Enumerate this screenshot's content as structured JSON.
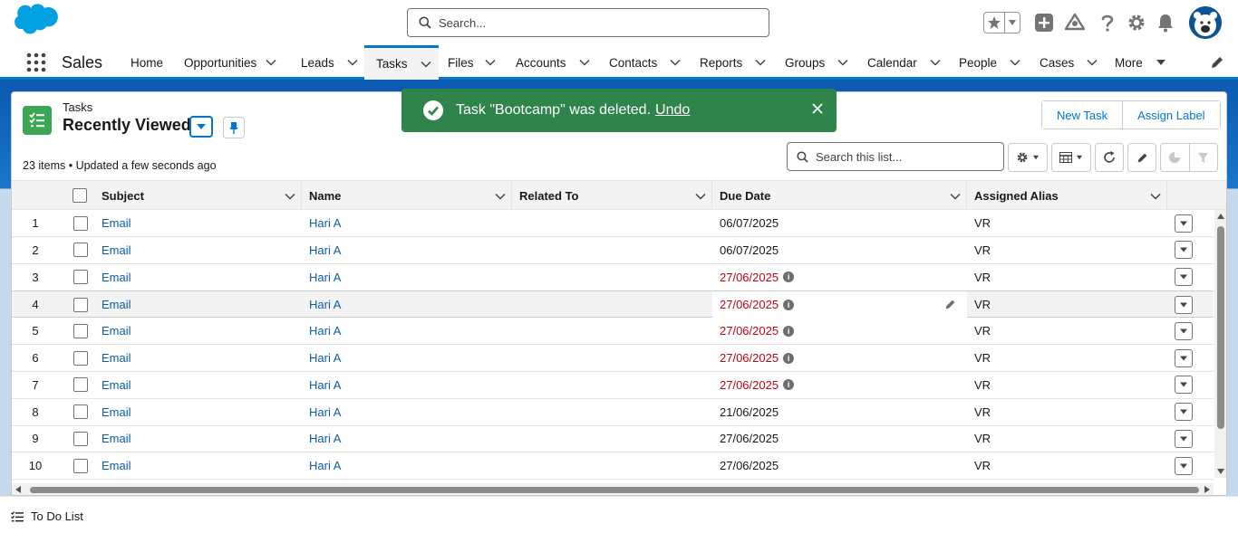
{
  "header": {
    "search_placeholder": "Search...",
    "icons": [
      "favorites-star-icon",
      "add-icon",
      "trailhead-icon",
      "help-icon",
      "setup-gear-icon",
      "notifications-bell-icon",
      "avatar"
    ]
  },
  "nav": {
    "app_name": "Sales",
    "items": [
      {
        "label": "Home"
      },
      {
        "label": "Opportunities"
      },
      {
        "label": "Leads"
      },
      {
        "label": "Tasks"
      },
      {
        "label": "Files"
      },
      {
        "label": "Accounts"
      },
      {
        "label": "Contacts"
      },
      {
        "label": "Reports"
      },
      {
        "label": "Groups"
      },
      {
        "label": "Calendar"
      },
      {
        "label": "People"
      },
      {
        "label": "Cases"
      },
      {
        "label": "More"
      }
    ],
    "active": "Tasks"
  },
  "list": {
    "object_label": "Tasks",
    "title": "Recently Viewed",
    "meta": "23 items • Updated a few seconds ago",
    "new_button": "New Task",
    "assign_button": "Assign Label",
    "search_placeholder": "Search this list...",
    "columns": [
      "Subject",
      "Name",
      "Related To",
      "Due Date",
      "Assigned Alias"
    ],
    "rows": [
      {
        "num": "1",
        "subject": "Email",
        "name": "Hari A",
        "related": "",
        "due": "06/07/2025",
        "overdue": false,
        "alias": "VR"
      },
      {
        "num": "2",
        "subject": "Email",
        "name": "Hari A",
        "related": "",
        "due": "06/07/2025",
        "overdue": false,
        "alias": "VR"
      },
      {
        "num": "3",
        "subject": "Email",
        "name": "Hari A",
        "related": "",
        "due": "27/06/2025",
        "overdue": true,
        "alias": "VR"
      },
      {
        "num": "4",
        "subject": "Email",
        "name": "Hari A",
        "related": "",
        "due": "27/06/2025",
        "overdue": true,
        "alias": "VR"
      },
      {
        "num": "5",
        "subject": "Email",
        "name": "Hari A",
        "related": "",
        "due": "27/06/2025",
        "overdue": true,
        "alias": "VR"
      },
      {
        "num": "6",
        "subject": "Email",
        "name": "Hari A",
        "related": "",
        "due": "27/06/2025",
        "overdue": true,
        "alias": "VR"
      },
      {
        "num": "7",
        "subject": "Email",
        "name": "Hari A",
        "related": "",
        "due": "27/06/2025",
        "overdue": true,
        "alias": "VR"
      },
      {
        "num": "8",
        "subject": "Email",
        "name": "Hari A",
        "related": "",
        "due": "21/06/2025",
        "overdue": false,
        "alias": "VR"
      },
      {
        "num": "9",
        "subject": "Email",
        "name": "Hari A",
        "related": "",
        "due": "27/06/2025",
        "overdue": false,
        "alias": "VR"
      },
      {
        "num": "10",
        "subject": "Email",
        "name": "Hari A",
        "related": "",
        "due": "27/06/2025",
        "overdue": false,
        "alias": "VR"
      }
    ],
    "highlighted_row": 4
  },
  "toast": {
    "message": "Task \"Bootcamp\" was deleted.",
    "action": "Undo",
    "color": "#2e844a"
  },
  "utility_bar": {
    "item": "To Do List"
  },
  "colors": {
    "brand": "#0176d3",
    "link": "#0b5cab",
    "overdue": "#ba0517",
    "task_icon": "#3ba755"
  }
}
